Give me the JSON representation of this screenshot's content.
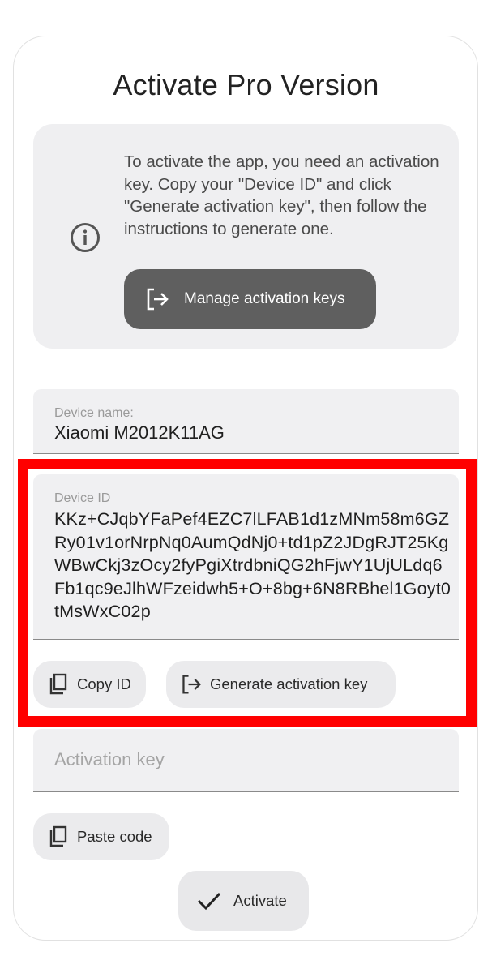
{
  "dialog": {
    "title": "Activate Pro Version"
  },
  "info": {
    "icon": "info-icon",
    "text": "To activate the app, you need an activation key. Copy your \"Device ID\" and click \"Generate activation key\", then follow the instructions to generate one.",
    "manage_button": {
      "icon": "login-arrow-icon",
      "label": "Manage activation keys"
    }
  },
  "device_name": {
    "caption": "Device name:",
    "value": "Xiaomi M2012K11AG"
  },
  "device_id": {
    "caption": "Device ID",
    "value": "KKz+CJqbYFaPef4EZC7lLFAB1d1zMNm58m6GZRy01v1orNrpNq0AumQdNj0+td1pZ2JDgRJT25KgWBwCkj3zOcy2fyPgiXtrdbniQG2hFjwY1UjULdq6Fb1qc9eJlhWFzeidwh5+O+8bg+6N8RBhel1Goyt0tMsWxC02p"
  },
  "buttons": {
    "copy_id": {
      "icon": "copy-icon",
      "label": "Copy ID"
    },
    "generate": {
      "icon": "login-arrow-icon",
      "label": "Generate activation key"
    },
    "paste": {
      "icon": "copy-icon",
      "label": "Paste code"
    },
    "activate": {
      "icon": "check-icon",
      "label": "Activate"
    }
  },
  "activation_key": {
    "placeholder": "Activation key",
    "value": ""
  },
  "colors": {
    "highlight": "#ff0000",
    "manage_button_bg": "#5f5f5f",
    "card_bg": "#efeff1"
  }
}
